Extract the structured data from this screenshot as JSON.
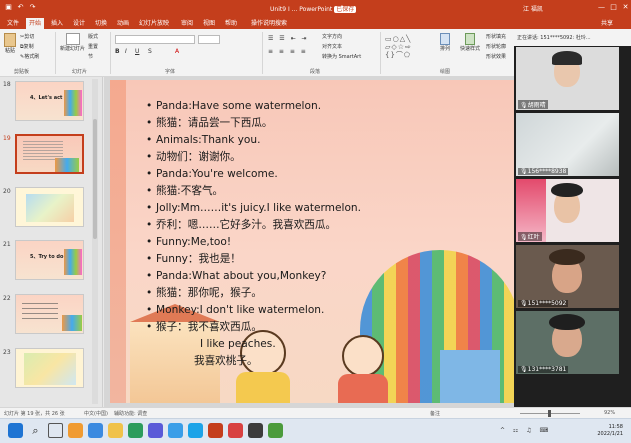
{
  "titlebar": {
    "title": "Unit9 I ... PowerPoint",
    "tag": "已保存",
    "user": "江 福凯",
    "share": "共享",
    "colors": {
      "accent": "#c43e1c"
    }
  },
  "tabs": [
    "文件",
    "开始",
    "插入",
    "设计",
    "切换",
    "动画",
    "幻灯片放映",
    "审阅",
    "视图",
    "帮助",
    "操作说明搜索"
  ],
  "ribbon": {
    "clipboard": {
      "label": "剪贴板",
      "paste": "粘贴",
      "cut": "剪切",
      "copy": "复制",
      "format": "格式刷"
    },
    "slides": {
      "label": "幻灯片",
      "new": "新建幻灯片",
      "layout": "版式",
      "reset": "重置",
      "section": "节"
    },
    "font": {
      "label": "字体"
    },
    "paragraph": {
      "label": "段落",
      "textdir": "文字方向",
      "align": "对齐文本",
      "smartart": "转换为 SmartArt"
    },
    "drawing": {
      "label": "绘图",
      "arrange": "排列",
      "quickstyles": "快速样式",
      "fill": "形状填充",
      "outline": "形状轮廓",
      "effect": "形状效果"
    }
  },
  "thumbnails": [
    {
      "num": "18",
      "label": "4、Let's act"
    },
    {
      "num": "19",
      "label": ""
    },
    {
      "num": "20",
      "label": ""
    },
    {
      "num": "21",
      "label": "5、Try to do"
    },
    {
      "num": "22",
      "label": ""
    },
    {
      "num": "23",
      "label": ""
    }
  ],
  "slide": {
    "lines": [
      "Panda:Have some watermelon.",
      "熊猫：请品尝一下西瓜。",
      "Animals:Thank you.",
      "动物们：谢谢你。",
      "Panda:You're welcome.",
      "熊猫:不客气。",
      "Jolly:Mm……it's juicy.I like watermelon.",
      "乔利：嗯……它好多汁。我喜欢西瓜。",
      "Funny:Me,too!",
      "Funny：我也是！",
      "Panda:What about you,Monkey?",
      "熊猫：那你呢，猴子。",
      "Monkey:I don't like watermelon.",
      "猴子：我不喜欢西瓜。"
    ],
    "sub1": "I like peaches.",
    "sub2": "我喜欢桃子。"
  },
  "participants": {
    "header": "正在讲话: 151****5092: 杜玲...",
    "tiles": [
      {
        "name": "胡雨晴"
      },
      {
        "name": "156****8938"
      },
      {
        "name": "红叶"
      },
      {
        "name": "151****5092"
      },
      {
        "name": "131****3781"
      }
    ]
  },
  "status": {
    "slide_info": "幻灯片 第 19 张，共 26 张",
    "lang": "中文(中国)",
    "access": "辅助功能: 调查",
    "notes": "备注",
    "zoom": "92%"
  },
  "clock": {
    "time": "11:58",
    "date": "2022/1/21"
  }
}
